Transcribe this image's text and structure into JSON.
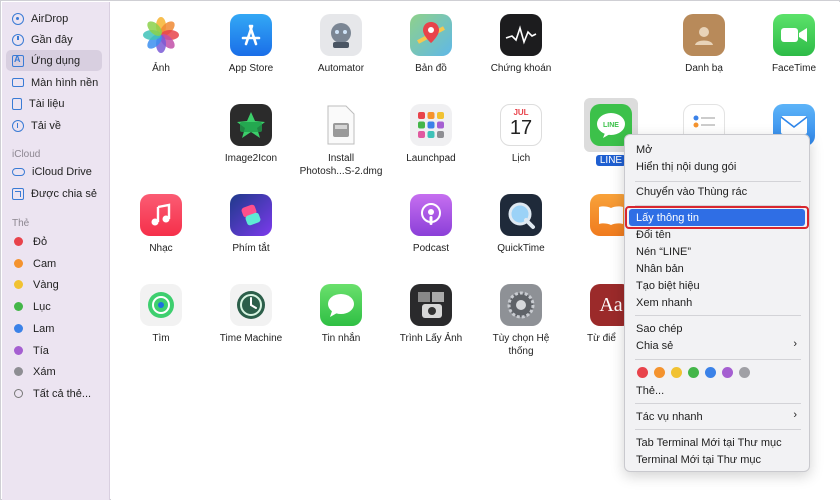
{
  "sidebar": {
    "favorites": [
      {
        "label": "AirDrop",
        "icon": "airdrop-icon"
      },
      {
        "label": "Gần đây",
        "icon": "clock-icon"
      },
      {
        "label": "Ứng dụng",
        "icon": "applications-icon",
        "active": true
      },
      {
        "label": "Màn hình nền",
        "icon": "desktop-icon"
      },
      {
        "label": "Tài liệu",
        "icon": "document-icon"
      },
      {
        "label": "Tải về",
        "icon": "download-icon"
      }
    ],
    "icloud_header": "iCloud",
    "icloud": [
      {
        "label": "iCloud Drive",
        "icon": "cloud-icon"
      },
      {
        "label": "Được chia sẻ",
        "icon": "shared-folder-icon"
      }
    ],
    "tags_header": "Thẻ",
    "tags": [
      {
        "label": "Đỏ",
        "color": "#e8434b"
      },
      {
        "label": "Cam",
        "color": "#f4932e"
      },
      {
        "label": "Vàng",
        "color": "#f1c232"
      },
      {
        "label": "Lục",
        "color": "#44b649"
      },
      {
        "label": "Lam",
        "color": "#3b82e8"
      },
      {
        "label": "Tía",
        "color": "#a55fd1"
      },
      {
        "label": "Xám",
        "color": "#8e8e93"
      },
      {
        "label": "Tất cả thẻ...",
        "color": ""
      }
    ]
  },
  "apps": [
    {
      "label": "Ảnh",
      "icon": "photos-icon"
    },
    {
      "label": "App Store",
      "icon": "app-store-icon"
    },
    {
      "label": "Automator",
      "icon": "automator-icon"
    },
    {
      "label": "Bản đồ",
      "icon": "maps-icon"
    },
    {
      "label": "Chứng khoán",
      "icon": "stocks-icon"
    },
    {
      "label": "Danh bạ",
      "icon": "contacts-icon"
    },
    {
      "label": "FaceTime",
      "icon": "facetime-icon"
    },
    {
      "label": "Image2Icon",
      "icon": "image2icon-icon"
    },
    {
      "label": "Install\nPhotosh...S-2.dmg",
      "icon": "dmg-file-icon"
    },
    {
      "label": "Launchpad",
      "icon": "launchpad-icon"
    },
    {
      "label": "Lịch",
      "icon": "calendar-icon",
      "month": "JUL",
      "day": "17"
    },
    {
      "label": "LINE",
      "icon": "line-icon",
      "selected": true
    },
    {
      "label": "Nhạc",
      "icon": "music-icon"
    },
    {
      "label": "Phím tắt",
      "icon": "shortcuts-icon"
    },
    {
      "label": "Podcast",
      "icon": "podcast-icon"
    },
    {
      "label": "QuickTime",
      "icon": "quicktime-icon"
    },
    {
      "label": "Tìm",
      "icon": "find-my-icon"
    },
    {
      "label": "Time Machine",
      "icon": "time-machine-icon"
    },
    {
      "label": "Tin nhắn",
      "icon": "messages-icon"
    },
    {
      "label": "Trình Lấy Ảnh",
      "icon": "image-capture-icon"
    },
    {
      "label": "Tùy chọn Hệ\nthống",
      "icon": "system-preferences-icon"
    },
    {
      "label": "Từ điể",
      "icon": "dictionary-icon"
    }
  ],
  "context_menu": {
    "items": [
      {
        "label": "Mở"
      },
      {
        "label": "Hiển thị nội dung gói"
      },
      {
        "label": "Chuyển vào Thùng rác"
      },
      {
        "label": "Lấy thông tin",
        "highlighted": true
      },
      {
        "label": "Đổi tên"
      },
      {
        "label": "Nén “LINE”"
      },
      {
        "label": "Nhân bản"
      },
      {
        "label": "Tạo biệt hiệu"
      },
      {
        "label": "Xem nhanh"
      },
      {
        "label": "Sao chép"
      },
      {
        "label": "Chia sẻ",
        "submenu": true
      },
      {
        "label": "Thẻ..."
      },
      {
        "label": "Tác vụ nhanh",
        "submenu": true
      },
      {
        "label": "Tab Terminal Mới tại Thư mục"
      },
      {
        "label": "Terminal Mới tại Thư mục"
      }
    ],
    "tag_colors": [
      "#e8434b",
      "#f4932e",
      "#f1c232",
      "#44b649",
      "#3b82e8",
      "#a55fd1",
      "#a0a0a5"
    ],
    "submenu_glyph": "›"
  }
}
